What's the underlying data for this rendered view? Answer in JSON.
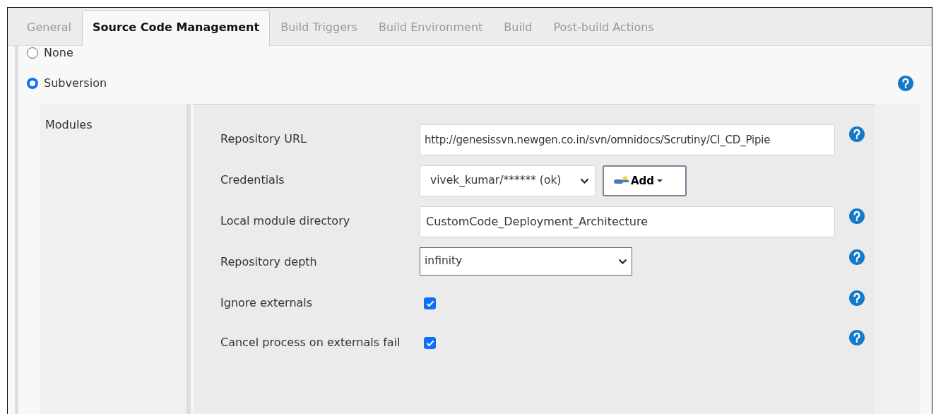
{
  "tabs": [
    {
      "label": "General",
      "selected": false
    },
    {
      "label": "Source Code Management",
      "selected": true
    },
    {
      "label": "Build Triggers",
      "selected": false
    },
    {
      "label": "Build Environment",
      "selected": false
    },
    {
      "label": "Build",
      "selected": false
    },
    {
      "label": "Post-build Actions",
      "selected": false
    }
  ],
  "scm_options": [
    {
      "label": "None",
      "selected": false,
      "help": false
    },
    {
      "label": "Subversion",
      "selected": true,
      "help": true
    }
  ],
  "modules": {
    "label": "Modules",
    "fields": [
      {
        "kind": "text",
        "label": "Repository URL",
        "value": "http://genesissvn.newgen.co.in/svn/omnidocs/Scrutiny/CI_CD_Pipie",
        "help": true
      },
      {
        "kind": "credentials",
        "label": "Credentials",
        "value": "vivek_kumar/****** (ok)",
        "button": "Add",
        "help": false
      },
      {
        "kind": "text",
        "label": "Local module directory",
        "value": "CustomCode_Deployment_Architecture",
        "help": true
      },
      {
        "kind": "select",
        "label": "Repository depth",
        "value": "infinity",
        "help": true
      },
      {
        "kind": "checkbox",
        "label": "Ignore externals",
        "checked": true,
        "help": true
      },
      {
        "kind": "checkbox",
        "label": "Cancel process on externals fail",
        "checked": true,
        "help": true
      }
    ]
  }
}
